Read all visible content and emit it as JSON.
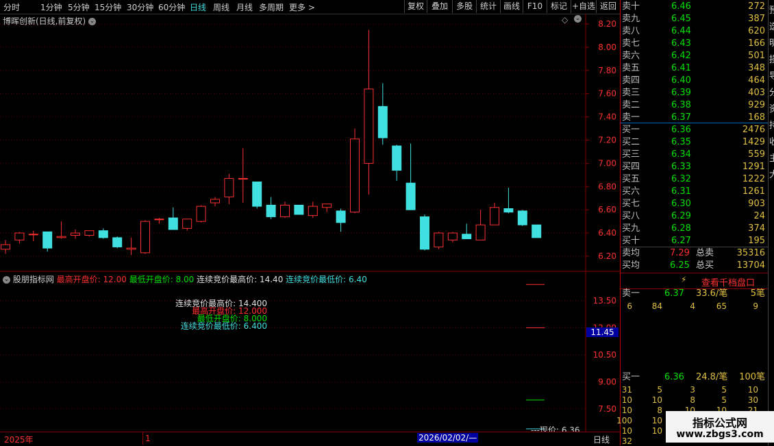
{
  "toolbar": {
    "left": [
      "分时",
      "1分钟",
      "5分钟",
      "15分钟",
      "30分钟",
      "60分钟",
      "日线",
      "周线",
      "月线",
      "多周期",
      "更多 >"
    ],
    "active": "日线",
    "right": [
      "复权",
      "叠加",
      "多股",
      "统计",
      "画线",
      "F10",
      "标记",
      "+自选",
      "返回"
    ]
  },
  "main_title": "博晖创新(日线,前复权)",
  "price_axis": [
    "8.20",
    "8.00",
    "7.80",
    "7.60",
    "7.40",
    "7.20",
    "7.00",
    "6.80",
    "6.60",
    "6.40",
    "6.20"
  ],
  "indicator": {
    "name": "股朋指标网",
    "legend": [
      {
        "text": "最高开盘价: 12.00",
        "color": "#ff3030"
      },
      {
        "text": "最低开盘价: 8.00",
        "color": "#00e000"
      },
      {
        "text": "连续竞价最高价: 14.40",
        "color": "#e0e0e0"
      },
      {
        "text": "连续竞价最低价: 6.40",
        "color": "#40e0e0"
      }
    ],
    "overlay": [
      {
        "text": "连续竞价最高价: 14.400",
        "color": "#e0e0e0"
      },
      {
        "text": "最高开盘价: 12.000",
        "color": "#ff3030"
      },
      {
        "text": "最低开盘价: 8.000",
        "color": "#00e000"
      },
      {
        "text": "连续竞价最低价: 6.400",
        "color": "#40e0e0"
      }
    ],
    "axis": [
      "13.50",
      "12.00",
      "10.50",
      "9.00",
      "7.50"
    ],
    "cursor_value": "11.45",
    "now_price": "---现价: 6.36"
  },
  "bottom_bar": {
    "year": "2025年",
    "mark": "1",
    "date": "2026/02/02/—",
    "period": "日线"
  },
  "orderbook": {
    "asks": [
      {
        "label": "卖十",
        "price": "6.46",
        "vol": "272"
      },
      {
        "label": "卖九",
        "price": "6.45",
        "vol": "387"
      },
      {
        "label": "卖八",
        "price": "6.44",
        "vol": "620"
      },
      {
        "label": "卖七",
        "price": "6.43",
        "vol": "166"
      },
      {
        "label": "卖六",
        "price": "6.42",
        "vol": "501"
      },
      {
        "label": "卖五",
        "price": "6.41",
        "vol": "348"
      },
      {
        "label": "卖四",
        "price": "6.40",
        "vol": "464"
      },
      {
        "label": "卖三",
        "price": "6.39",
        "vol": "403"
      },
      {
        "label": "卖二",
        "price": "6.38",
        "vol": "929"
      },
      {
        "label": "卖一",
        "price": "6.37",
        "vol": "168"
      }
    ],
    "bids": [
      {
        "label": "买一",
        "price": "6.36",
        "vol": "2476"
      },
      {
        "label": "买二",
        "price": "6.35",
        "vol": "1429"
      },
      {
        "label": "买三",
        "price": "6.34",
        "vol": "559"
      },
      {
        "label": "买四",
        "price": "6.33",
        "vol": "1291"
      },
      {
        "label": "买五",
        "price": "6.32",
        "vol": "1222"
      },
      {
        "label": "买六",
        "price": "6.31",
        "vol": "1261"
      },
      {
        "label": "买七",
        "price": "6.30",
        "vol": "903"
      },
      {
        "label": "买八",
        "price": "6.29",
        "vol": "24"
      },
      {
        "label": "买九",
        "price": "6.28",
        "vol": "374"
      },
      {
        "label": "买十",
        "price": "6.27",
        "vol": "195"
      }
    ],
    "avg_sell": {
      "label": "卖均",
      "price": "7.29",
      "tot_label": "总卖",
      "tot": "35316"
    },
    "avg_buy": {
      "label": "买均",
      "price": "6.25",
      "tot_label": "总买",
      "tot": "13704"
    },
    "depth_button": "查看千档盘口",
    "ask1": {
      "label": "卖一",
      "price": "6.37",
      "per": "33.6/笔",
      "count": "5笔"
    },
    "ask1_orders": [
      "6",
      "84",
      "4",
      "65",
      "9"
    ],
    "bid1": {
      "label": "买一",
      "price": "6.36",
      "per": "24.8/笔",
      "count": "100笔"
    },
    "bid1_orders": [
      [
        "31",
        "5",
        "3",
        "5",
        "10"
      ],
      [
        "10",
        "10",
        "8",
        "5",
        "30"
      ],
      [
        "10",
        "8",
        "10",
        "10",
        "21"
      ],
      [
        "100",
        "10",
        "10",
        "10",
        "10"
      ],
      [
        "10",
        "10",
        "10",
        "10",
        "10"
      ],
      [
        "32",
        "",
        "",
        "",
        ""
      ]
    ]
  },
  "side_strip": [
    "预",
    "迭",
    "明",
    "损",
    "导",
    "分",
    "资",
    "持",
    "收",
    "主",
    "大"
  ],
  "watermark": {
    "title": "指标公式网",
    "url": "www.zbgs3.com"
  },
  "colors": {
    "up": "#ff3030",
    "down": "#40e0e0",
    "grid": "#8b0000",
    "bg": "#000000"
  },
  "chart_data": {
    "type": "candlestick",
    "ylim": [
      6.1,
      8.3
    ],
    "candles": [
      {
        "o": 6.26,
        "h": 6.34,
        "l": 6.22,
        "c": 6.3
      },
      {
        "o": 6.34,
        "h": 6.41,
        "l": 6.31,
        "c": 6.4
      },
      {
        "o": 6.39,
        "h": 6.42,
        "l": 6.33,
        "c": 6.39
      },
      {
        "o": 6.41,
        "h": 6.41,
        "l": 6.24,
        "c": 6.27
      },
      {
        "o": 6.36,
        "h": 6.5,
        "l": 6.35,
        "c": 6.37
      },
      {
        "o": 6.38,
        "h": 6.43,
        "l": 6.35,
        "c": 6.4
      },
      {
        "o": 6.38,
        "h": 6.42,
        "l": 6.37,
        "c": 6.42
      },
      {
        "o": 6.42,
        "h": 6.44,
        "l": 6.35,
        "c": 6.36
      },
      {
        "o": 6.36,
        "h": 6.37,
        "l": 6.27,
        "c": 6.28
      },
      {
        "o": 6.26,
        "h": 6.36,
        "l": 6.21,
        "c": 6.27
      },
      {
        "o": 6.23,
        "h": 6.51,
        "l": 6.22,
        "c": 6.5
      },
      {
        "o": 6.52,
        "h": 6.53,
        "l": 6.48,
        "c": 6.52
      },
      {
        "o": 6.53,
        "h": 6.62,
        "l": 6.43,
        "c": 6.43
      },
      {
        "o": 6.44,
        "h": 6.51,
        "l": 6.42,
        "c": 6.52
      },
      {
        "o": 6.5,
        "h": 6.64,
        "l": 6.49,
        "c": 6.63
      },
      {
        "o": 6.66,
        "h": 6.71,
        "l": 6.63,
        "c": 6.69
      },
      {
        "o": 6.71,
        "h": 6.91,
        "l": 6.65,
        "c": 6.87
      },
      {
        "o": 6.87,
        "h": 7.13,
        "l": 6.66,
        "c": 6.87
      },
      {
        "o": 6.84,
        "h": 6.84,
        "l": 6.61,
        "c": 6.63
      },
      {
        "o": 6.64,
        "h": 6.71,
        "l": 6.52,
        "c": 6.54
      },
      {
        "o": 6.54,
        "h": 6.67,
        "l": 6.53,
        "c": 6.64
      },
      {
        "o": 6.64,
        "h": 6.64,
        "l": 6.56,
        "c": 6.56
      },
      {
        "o": 6.55,
        "h": 6.67,
        "l": 6.53,
        "c": 6.63
      },
      {
        "o": 6.62,
        "h": 6.65,
        "l": 6.58,
        "c": 6.65
      },
      {
        "o": 6.59,
        "h": 6.61,
        "l": 6.41,
        "c": 6.49
      },
      {
        "o": 6.58,
        "h": 7.3,
        "l": 6.57,
        "c": 7.21
      },
      {
        "o": 7.0,
        "h": 8.15,
        "l": 6.73,
        "c": 7.64
      },
      {
        "o": 7.49,
        "h": 7.69,
        "l": 7.16,
        "c": 7.22
      },
      {
        "o": 7.15,
        "h": 7.16,
        "l": 6.85,
        "c": 6.94
      },
      {
        "o": 6.83,
        "h": 7.17,
        "l": 6.64,
        "c": 6.6
      },
      {
        "o": 6.54,
        "h": 6.56,
        "l": 6.25,
        "c": 6.26
      },
      {
        "o": 6.28,
        "h": 6.41,
        "l": 6.26,
        "c": 6.4
      },
      {
        "o": 6.34,
        "h": 6.41,
        "l": 6.32,
        "c": 6.4
      },
      {
        "o": 6.39,
        "h": 6.48,
        "l": 6.35,
        "c": 6.35
      },
      {
        "o": 6.34,
        "h": 6.6,
        "l": 6.34,
        "c": 6.47
      },
      {
        "o": 6.47,
        "h": 6.66,
        "l": 6.47,
        "c": 6.62
      },
      {
        "o": 6.61,
        "h": 6.79,
        "l": 6.57,
        "c": 6.58
      },
      {
        "o": 6.59,
        "h": 6.6,
        "l": 6.46,
        "c": 6.47
      },
      {
        "o": 6.47,
        "h": 6.47,
        "l": 6.37,
        "c": 6.36
      }
    ]
  }
}
